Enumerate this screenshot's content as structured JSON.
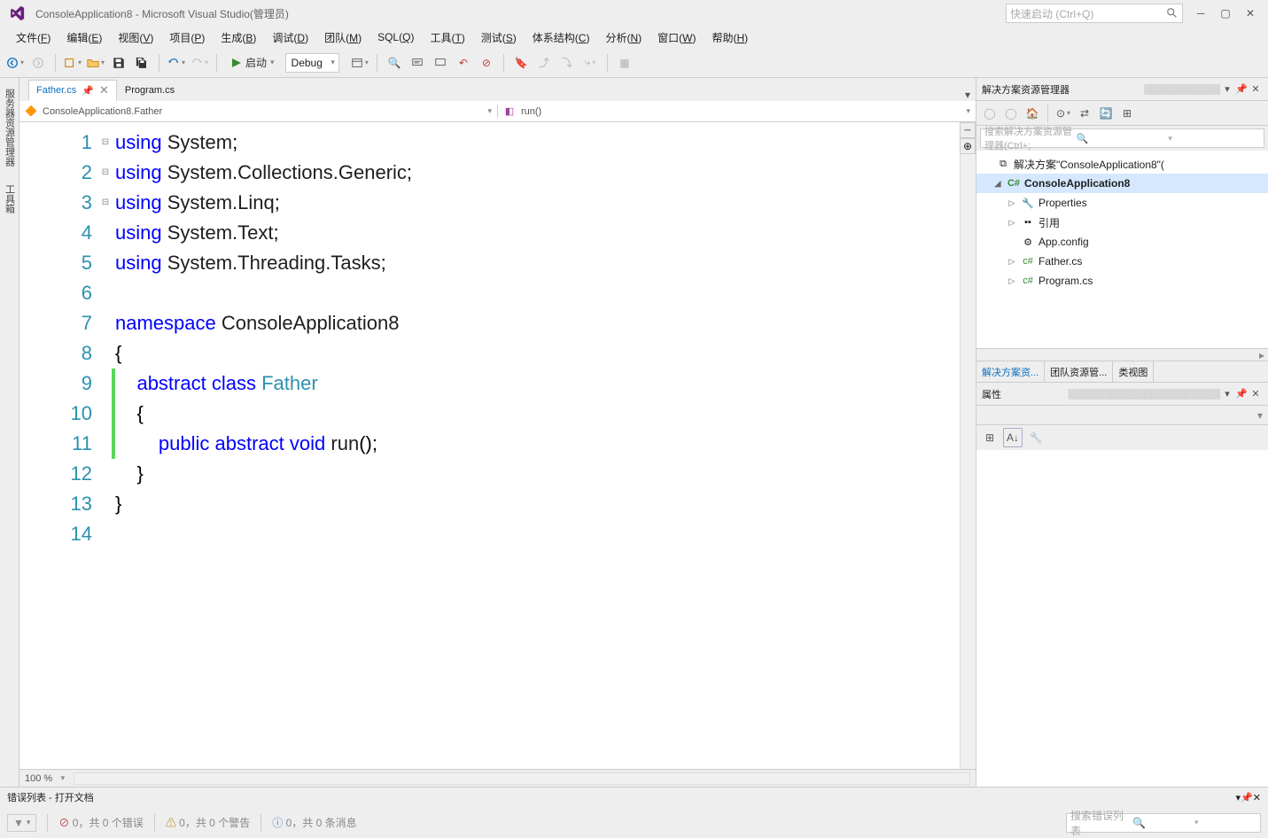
{
  "title": "ConsoleApplication8 - Microsoft Visual Studio(管理员)",
  "quick_launch_placeholder": "快速启动 (Ctrl+Q)",
  "menu": [
    "文件(F)",
    "编辑(E)",
    "视图(V)",
    "项目(P)",
    "生成(B)",
    "调试(D)",
    "团队(M)",
    "SQL(Q)",
    "工具(T)",
    "测试(S)",
    "体系结构(C)",
    "分析(N)",
    "窗口(W)",
    "帮助(H)"
  ],
  "toolbar": {
    "start_label": "启动",
    "config": "Debug"
  },
  "left_tabs": [
    "服务器资源管理器",
    "工具箱"
  ],
  "tabs": [
    {
      "name": "Father.cs",
      "active": true
    },
    {
      "name": "Program.cs",
      "active": false
    }
  ],
  "nav": {
    "left": "ConsoleApplication8.Father",
    "right": "run()"
  },
  "code_lines": [
    {
      "n": 1,
      "outline": "⊟",
      "tokens": [
        [
          "kw",
          "using"
        ],
        [
          "",
          ""
        ],
        [
          "",
          "System"
        ],
        [
          "punct",
          ";"
        ]
      ]
    },
    {
      "n": 2,
      "tokens": [
        [
          "kw",
          "using"
        ],
        [
          "",
          ""
        ],
        [
          "",
          "System.Collections.Generic"
        ],
        [
          "punct",
          ";"
        ]
      ]
    },
    {
      "n": 3,
      "tokens": [
        [
          "kw",
          "using"
        ],
        [
          "",
          ""
        ],
        [
          "",
          "System.Linq"
        ],
        [
          "punct",
          ";"
        ]
      ]
    },
    {
      "n": 4,
      "tokens": [
        [
          "kw",
          "using"
        ],
        [
          "",
          ""
        ],
        [
          "",
          "System.Text"
        ],
        [
          "punct",
          ";"
        ]
      ]
    },
    {
      "n": 5,
      "tokens": [
        [
          "kw",
          "using"
        ],
        [
          "",
          ""
        ],
        [
          "",
          "System.Threading.Tasks"
        ],
        [
          "punct",
          ";"
        ]
      ]
    },
    {
      "n": 6,
      "tokens": []
    },
    {
      "n": 7,
      "outline": "⊟",
      "tokens": [
        [
          "kw",
          "namespace"
        ],
        [
          "",
          ""
        ],
        [
          "",
          "ConsoleApplication8"
        ]
      ]
    },
    {
      "n": 8,
      "tokens": [
        [
          "punct",
          "{"
        ]
      ]
    },
    {
      "n": 9,
      "outline": "⊟",
      "mod": true,
      "tokens": [
        [
          "",
          "    "
        ],
        [
          "kw",
          "abstract"
        ],
        [
          "",
          ""
        ],
        [
          "kw",
          "class"
        ],
        [
          "",
          ""
        ],
        [
          "type",
          "Father"
        ]
      ]
    },
    {
      "n": 10,
      "mod": true,
      "tokens": [
        [
          "",
          "    "
        ],
        [
          "punct",
          "{"
        ]
      ]
    },
    {
      "n": 11,
      "mod": true,
      "tokens": [
        [
          "",
          "        "
        ],
        [
          "kw",
          "public"
        ],
        [
          "",
          ""
        ],
        [
          "kw",
          "abstract"
        ],
        [
          "",
          ""
        ],
        [
          "kw",
          "void"
        ],
        [
          "",
          ""
        ],
        [
          "",
          "run"
        ],
        [
          "punct",
          "();"
        ]
      ]
    },
    {
      "n": 12,
      "tokens": [
        [
          "",
          "    "
        ],
        [
          "punct",
          "}"
        ]
      ]
    },
    {
      "n": 13,
      "tokens": [
        [
          "punct",
          "}"
        ]
      ]
    },
    {
      "n": 14,
      "tokens": []
    }
  ],
  "zoom": "100 %",
  "solution_explorer": {
    "title": "解决方案资源管理器",
    "search_placeholder": "搜索解决方案资源管理器(Ctrl+;",
    "solution": "解决方案\"ConsoleApplication8\"(",
    "project": "ConsoleApplication8",
    "items": [
      "Properties",
      "引用",
      "App.config",
      "Father.cs",
      "Program.cs"
    ],
    "tabs": [
      "解决方案资...",
      "团队资源管...",
      "类视图"
    ]
  },
  "properties": {
    "title": "属性"
  },
  "error_list": {
    "title": "错误列表 - 打开文档",
    "errors": "0，共 0 个错误",
    "warnings": "0，共 0 个警告",
    "messages": "0，共 0 条消息",
    "search_placeholder": "搜索错误列表"
  }
}
